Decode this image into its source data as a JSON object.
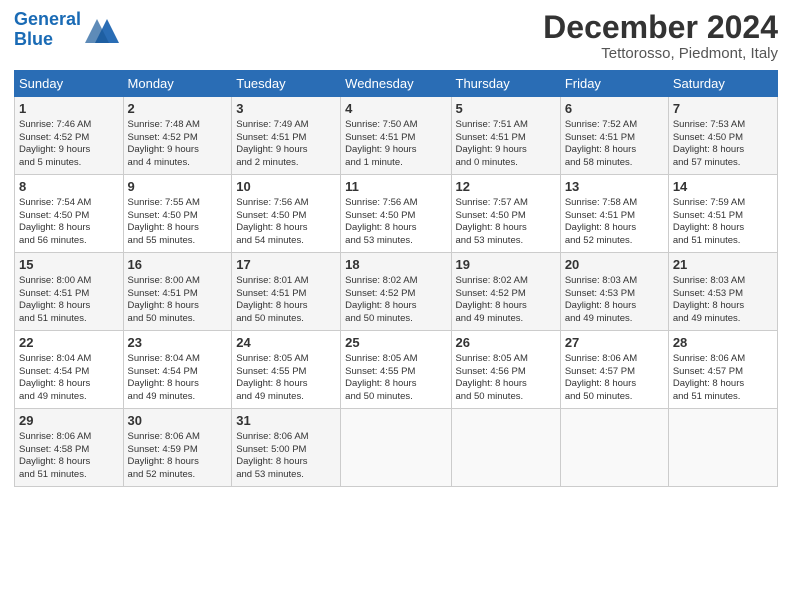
{
  "header": {
    "logo_line1": "General",
    "logo_line2": "Blue",
    "month": "December 2024",
    "location": "Tettorosso, Piedmont, Italy"
  },
  "weekdays": [
    "Sunday",
    "Monday",
    "Tuesday",
    "Wednesday",
    "Thursday",
    "Friday",
    "Saturday"
  ],
  "weeks": [
    [
      {
        "day": "1",
        "info": "Sunrise: 7:46 AM\nSunset: 4:52 PM\nDaylight: 9 hours\nand 5 minutes."
      },
      {
        "day": "2",
        "info": "Sunrise: 7:48 AM\nSunset: 4:52 PM\nDaylight: 9 hours\nand 4 minutes."
      },
      {
        "day": "3",
        "info": "Sunrise: 7:49 AM\nSunset: 4:51 PM\nDaylight: 9 hours\nand 2 minutes."
      },
      {
        "day": "4",
        "info": "Sunrise: 7:50 AM\nSunset: 4:51 PM\nDaylight: 9 hours\nand 1 minute."
      },
      {
        "day": "5",
        "info": "Sunrise: 7:51 AM\nSunset: 4:51 PM\nDaylight: 9 hours\nand 0 minutes."
      },
      {
        "day": "6",
        "info": "Sunrise: 7:52 AM\nSunset: 4:51 PM\nDaylight: 8 hours\nand 58 minutes."
      },
      {
        "day": "7",
        "info": "Sunrise: 7:53 AM\nSunset: 4:50 PM\nDaylight: 8 hours\nand 57 minutes."
      }
    ],
    [
      {
        "day": "8",
        "info": "Sunrise: 7:54 AM\nSunset: 4:50 PM\nDaylight: 8 hours\nand 56 minutes."
      },
      {
        "day": "9",
        "info": "Sunrise: 7:55 AM\nSunset: 4:50 PM\nDaylight: 8 hours\nand 55 minutes."
      },
      {
        "day": "10",
        "info": "Sunrise: 7:56 AM\nSunset: 4:50 PM\nDaylight: 8 hours\nand 54 minutes."
      },
      {
        "day": "11",
        "info": "Sunrise: 7:56 AM\nSunset: 4:50 PM\nDaylight: 8 hours\nand 53 minutes."
      },
      {
        "day": "12",
        "info": "Sunrise: 7:57 AM\nSunset: 4:50 PM\nDaylight: 8 hours\nand 53 minutes."
      },
      {
        "day": "13",
        "info": "Sunrise: 7:58 AM\nSunset: 4:51 PM\nDaylight: 8 hours\nand 52 minutes."
      },
      {
        "day": "14",
        "info": "Sunrise: 7:59 AM\nSunset: 4:51 PM\nDaylight: 8 hours\nand 51 minutes."
      }
    ],
    [
      {
        "day": "15",
        "info": "Sunrise: 8:00 AM\nSunset: 4:51 PM\nDaylight: 8 hours\nand 51 minutes."
      },
      {
        "day": "16",
        "info": "Sunrise: 8:00 AM\nSunset: 4:51 PM\nDaylight: 8 hours\nand 50 minutes."
      },
      {
        "day": "17",
        "info": "Sunrise: 8:01 AM\nSunset: 4:51 PM\nDaylight: 8 hours\nand 50 minutes."
      },
      {
        "day": "18",
        "info": "Sunrise: 8:02 AM\nSunset: 4:52 PM\nDaylight: 8 hours\nand 50 minutes."
      },
      {
        "day": "19",
        "info": "Sunrise: 8:02 AM\nSunset: 4:52 PM\nDaylight: 8 hours\nand 49 minutes."
      },
      {
        "day": "20",
        "info": "Sunrise: 8:03 AM\nSunset: 4:53 PM\nDaylight: 8 hours\nand 49 minutes."
      },
      {
        "day": "21",
        "info": "Sunrise: 8:03 AM\nSunset: 4:53 PM\nDaylight: 8 hours\nand 49 minutes."
      }
    ],
    [
      {
        "day": "22",
        "info": "Sunrise: 8:04 AM\nSunset: 4:54 PM\nDaylight: 8 hours\nand 49 minutes."
      },
      {
        "day": "23",
        "info": "Sunrise: 8:04 AM\nSunset: 4:54 PM\nDaylight: 8 hours\nand 49 minutes."
      },
      {
        "day": "24",
        "info": "Sunrise: 8:05 AM\nSunset: 4:55 PM\nDaylight: 8 hours\nand 49 minutes."
      },
      {
        "day": "25",
        "info": "Sunrise: 8:05 AM\nSunset: 4:55 PM\nDaylight: 8 hours\nand 50 minutes."
      },
      {
        "day": "26",
        "info": "Sunrise: 8:05 AM\nSunset: 4:56 PM\nDaylight: 8 hours\nand 50 minutes."
      },
      {
        "day": "27",
        "info": "Sunrise: 8:06 AM\nSunset: 4:57 PM\nDaylight: 8 hours\nand 50 minutes."
      },
      {
        "day": "28",
        "info": "Sunrise: 8:06 AM\nSunset: 4:57 PM\nDaylight: 8 hours\nand 51 minutes."
      }
    ],
    [
      {
        "day": "29",
        "info": "Sunrise: 8:06 AM\nSunset: 4:58 PM\nDaylight: 8 hours\nand 51 minutes."
      },
      {
        "day": "30",
        "info": "Sunrise: 8:06 AM\nSunset: 4:59 PM\nDaylight: 8 hours\nand 52 minutes."
      },
      {
        "day": "31",
        "info": "Sunrise: 8:06 AM\nSunset: 5:00 PM\nDaylight: 8 hours\nand 53 minutes."
      },
      {
        "day": "",
        "info": ""
      },
      {
        "day": "",
        "info": ""
      },
      {
        "day": "",
        "info": ""
      },
      {
        "day": "",
        "info": ""
      }
    ]
  ]
}
